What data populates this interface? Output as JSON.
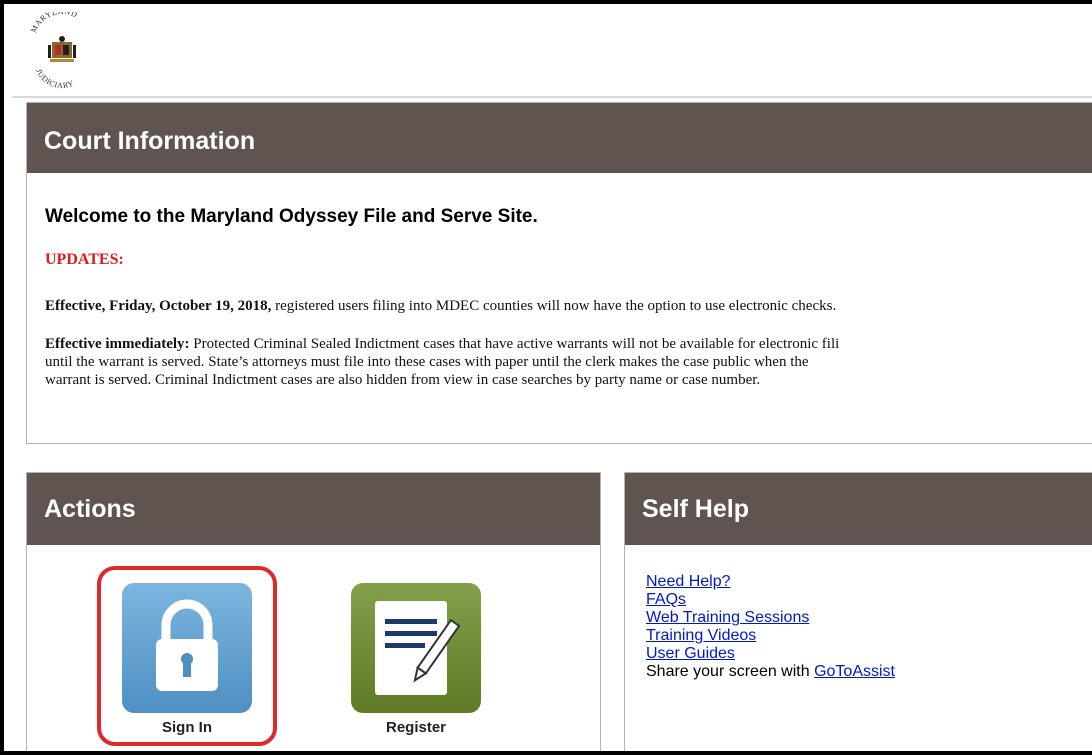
{
  "header": {
    "logo_text": "MARYLAND JUDICIARY"
  },
  "court_info": {
    "title": "Court Information",
    "welcome": "Welcome to the Maryland Odyssey File and Serve Site.",
    "updates_label": "UPDATES:",
    "update1_bold": "Effective, Friday, October 19, 2018,",
    "update1_text": " registered users filing into MDEC counties will now have the option to use electronic checks.",
    "update2_bold": "Effective immediately:",
    "update2_line1": " Protected Criminal Sealed Indictment cases that have active warrants will not be available for electronic fili",
    "update2_line2": "until the warrant is served. State’s attorneys must file into these cases with paper until the clerk makes the case public when the",
    "update2_line3": "warrant is served. Criminal Indictment cases are also hidden from view in case searches by party name or case number."
  },
  "actions": {
    "title": "Actions",
    "sign_in_label": "Sign In",
    "register_label": "Register"
  },
  "self_help": {
    "title": "Self Help",
    "links": [
      "Need Help?",
      "FAQs",
      "Web Training Sessions",
      "Training Videos",
      "User Guides"
    ],
    "share_text": "Share your screen with ",
    "share_link": "GoToAssist"
  },
  "colors": {
    "panel_header": "#5f5450",
    "updates_red": "#e01b1b",
    "link_blue": "#0018c8",
    "sign_in_tile": "#5b9bcc",
    "register_tile": "#6b8232",
    "highlight_red": "#dd2a2a"
  }
}
